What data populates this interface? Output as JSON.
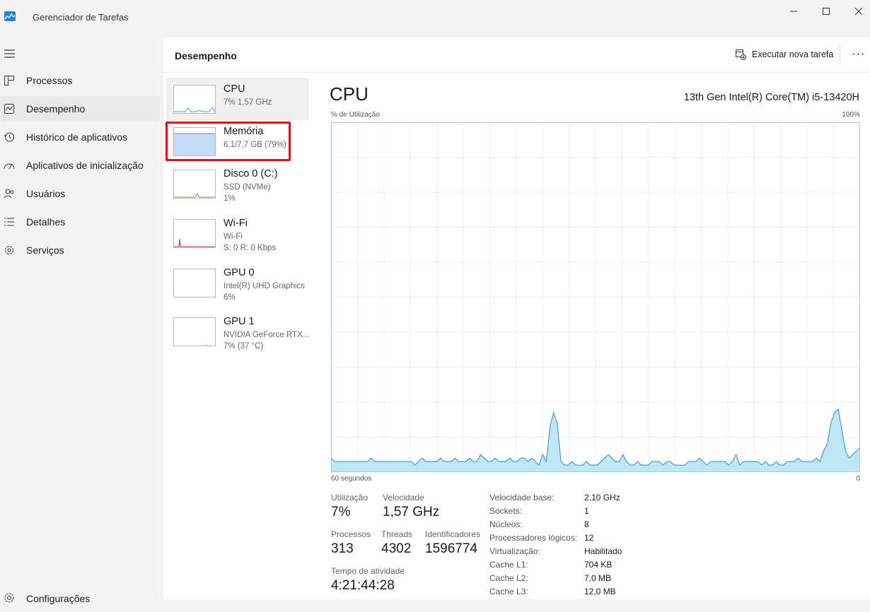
{
  "window": {
    "title": "Gerenciador de Tarefas"
  },
  "nav": {
    "items": [
      {
        "label": "Processos",
        "icon": "processes-icon"
      },
      {
        "label": "Desempenho",
        "icon": "performance-icon"
      },
      {
        "label": "Histórico de aplicativos",
        "icon": "history-icon"
      },
      {
        "label": "Aplicativos de inicialização",
        "icon": "startup-icon"
      },
      {
        "label": "Usuários",
        "icon": "users-icon"
      },
      {
        "label": "Detalhes",
        "icon": "details-icon"
      },
      {
        "label": "Serviços",
        "icon": "services-icon"
      }
    ],
    "active_index": 1,
    "settings_label": "Configurações"
  },
  "header": {
    "title": "Desempenho",
    "run_task_label": "Executar nova tarefa",
    "more_label": "···"
  },
  "devices": [
    {
      "name": "CPU",
      "line1": "7% 1,57 GHz",
      "line2": ""
    },
    {
      "name": "Memória",
      "line1": "6,1/7,7 GB (79%)",
      "line2": ""
    },
    {
      "name": "Disco 0 (C:)",
      "line1": "SSD (NVMe)",
      "line2": "1%"
    },
    {
      "name": "Wi-Fi",
      "line1": "Wi-Fi",
      "line2": "S: 0 R: 0 Kbps"
    },
    {
      "name": "GPU 0",
      "line1": "Intel(R) UHD Graphics",
      "line2": "6%"
    },
    {
      "name": "GPU 1",
      "line1": "NVIDIA GeForce RTX...",
      "line2": "7% (37 °C)"
    }
  ],
  "cpu": {
    "title": "CPU",
    "model": "13th Gen Intel(R) Core(TM) i5-13420H",
    "util_axis_label": "% de Utilização",
    "util_max_label": "100%",
    "time_left_label": "60 segundos",
    "time_right_label": "0",
    "graph_values": [
      4,
      3,
      3,
      3,
      3,
      3,
      3,
      3,
      3,
      3,
      3,
      4,
      3,
      3,
      3,
      3,
      3,
      3,
      3,
      3,
      3,
      3,
      3,
      2,
      3,
      4,
      3,
      3,
      3,
      3,
      4,
      3,
      3,
      3,
      4,
      3,
      3,
      3,
      4,
      3,
      3,
      5,
      4,
      3,
      3,
      4,
      3,
      3,
      3,
      4,
      3,
      3,
      4,
      4,
      3,
      4,
      3,
      2,
      5,
      3,
      13,
      17,
      14,
      3,
      2,
      2,
      3,
      2,
      2,
      2,
      3,
      2,
      2,
      2,
      3,
      4,
      5,
      4,
      3,
      3,
      5,
      3,
      2,
      2,
      3,
      2,
      2,
      2,
      3,
      3,
      3,
      2,
      3,
      3,
      2,
      2,
      2,
      2,
      3,
      3,
      3,
      4,
      3,
      2,
      3,
      3,
      3,
      3,
      3,
      2,
      3,
      5,
      2,
      3,
      3,
      3,
      3,
      3,
      2,
      3,
      2,
      2,
      3,
      2,
      2,
      3,
      3,
      3,
      4,
      3,
      3,
      3,
      3,
      4,
      3,
      6,
      8,
      14,
      17,
      18,
      12,
      6,
      4,
      5,
      6,
      7
    ],
    "stats": {
      "utilization_label": "Utilização",
      "utilization_value": "7%",
      "speed_label": "Velocidade",
      "speed_value": "1,57 GHz",
      "processes_label": "Processos",
      "processes_value": "313",
      "threads_label": "Threads",
      "threads_value": "4302",
      "handles_label": "Identificadores",
      "handles_value": "1596774",
      "uptime_label": "Tempo de atividade",
      "uptime_value": "4:21:44:28"
    },
    "info": [
      {
        "label": "Velocidade base:",
        "value": "2,10 GHz"
      },
      {
        "label": "Sockets:",
        "value": "1"
      },
      {
        "label": "Núcleos:",
        "value": "8"
      },
      {
        "label": "Processadores lógicos:",
        "value": "12"
      },
      {
        "label": "Virtualização:",
        "value": "Habilitado"
      },
      {
        "label": "Cache L1:",
        "value": "704 KB"
      },
      {
        "label": "Cache L2:",
        "value": "7,0 MB"
      },
      {
        "label": "Cache L3:",
        "value": "12,0 MB"
      }
    ]
  },
  "colors": {
    "graph_line": "#4a9fc7",
    "graph_fill": "#bfe6f5",
    "highlight": "#e3101a",
    "memory_fill": "#c5dcf7"
  }
}
